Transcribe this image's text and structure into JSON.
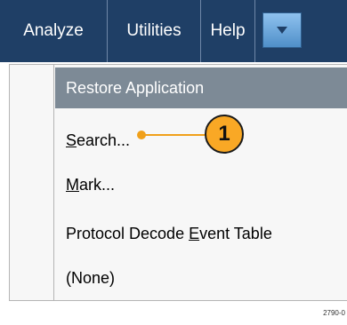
{
  "menubar": {
    "items": [
      {
        "label": "Analyze"
      },
      {
        "label": "Utilities"
      },
      {
        "label": "Help"
      }
    ]
  },
  "dropdown": {
    "items": [
      {
        "label": "Restore Application",
        "state": "highlighted"
      },
      {
        "pre": "",
        "ul": "S",
        "post": "earch..."
      },
      {
        "pre": "",
        "ul": "M",
        "post": "ark..."
      },
      {
        "pre": "Protocol Decode ",
        "ul": "E",
        "post": "vent Table"
      },
      {
        "label": "(None)"
      }
    ]
  },
  "callout": {
    "number": "1"
  },
  "figure_id": "2790-0",
  "colors": {
    "menubar": "#1f3f66",
    "highlight": "#7d8a96",
    "callout": "#f9a825"
  }
}
